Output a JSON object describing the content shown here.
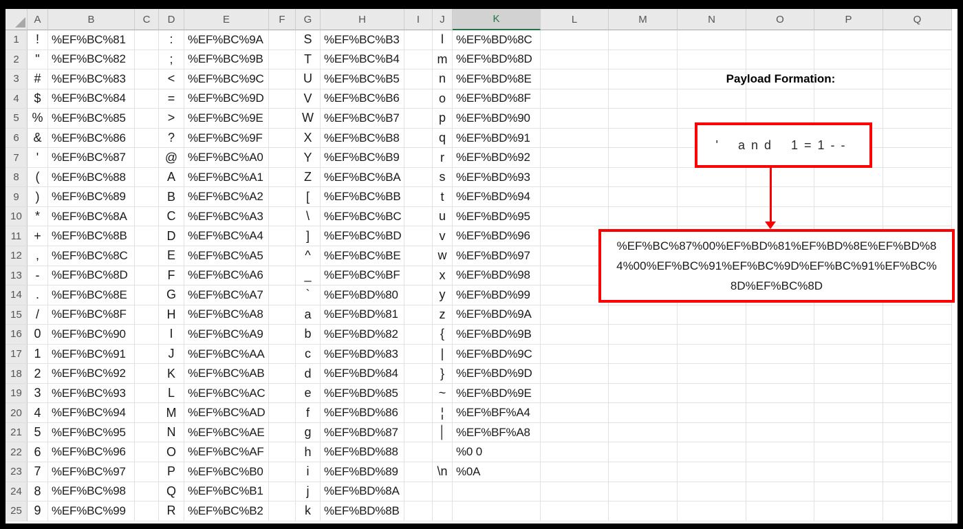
{
  "colors": {
    "annotation_red": "#fb0000",
    "excel_selected_green": "#217346",
    "header_bg": "#e9e9e9",
    "selected_header_bg": "#d2d2d2",
    "gridline": "#e2e2e2",
    "frame": "#000000"
  },
  "sheet": {
    "col_headers": [
      "A",
      "B",
      "C",
      "D",
      "E",
      "F",
      "G",
      "H",
      "I",
      "J",
      "K",
      "L",
      "M",
      "N",
      "O",
      "P",
      "Q"
    ],
    "selected_column": "K",
    "row_numbers": [
      1,
      2,
      3,
      4,
      5,
      6,
      7,
      8,
      9,
      10,
      11,
      12,
      13,
      14,
      15,
      16,
      17,
      18,
      19,
      20,
      21,
      22,
      23,
      24,
      25
    ],
    "rows": [
      [
        "!",
        "%EF%BC%81",
        ":",
        "%EF%BC%9A",
        "S",
        "%EF%BC%B3",
        "l",
        "%EF%BD%8C"
      ],
      [
        "\"",
        "%EF%BC%82",
        ";",
        "%EF%BC%9B",
        "T",
        "%EF%BC%B4",
        "m",
        "%EF%BD%8D"
      ],
      [
        "#",
        "%EF%BC%83",
        "<",
        "%EF%BC%9C",
        "U",
        "%EF%BC%B5",
        "n",
        "%EF%BD%8E"
      ],
      [
        "$",
        "%EF%BC%84",
        "=",
        "%EF%BC%9D",
        "V",
        "%EF%BC%B6",
        "o",
        "%EF%BD%8F"
      ],
      [
        "%",
        "%EF%BC%85",
        ">",
        "%EF%BC%9E",
        "W",
        "%EF%BC%B7",
        "p",
        "%EF%BD%90"
      ],
      [
        "&",
        "%EF%BC%86",
        "?",
        "%EF%BC%9F",
        "X",
        "%EF%BC%B8",
        "q",
        "%EF%BD%91"
      ],
      [
        "'",
        "%EF%BC%87",
        "@",
        "%EF%BC%A0",
        "Y",
        "%EF%BC%B9",
        "r",
        "%EF%BD%92"
      ],
      [
        "(",
        "%EF%BC%88",
        "A",
        "%EF%BC%A1",
        "Z",
        "%EF%BC%BA",
        "s",
        "%EF%BD%93"
      ],
      [
        ")",
        "%EF%BC%89",
        "B",
        "%EF%BC%A2",
        "[",
        "%EF%BC%BB",
        "t",
        "%EF%BD%94"
      ],
      [
        "*",
        "%EF%BC%8A",
        "C",
        "%EF%BC%A3",
        "\\",
        "%EF%BC%BC",
        "u",
        "%EF%BD%95"
      ],
      [
        "+",
        "%EF%BC%8B",
        "D",
        "%EF%BC%A4",
        "]",
        "%EF%BC%BD",
        "v",
        "%EF%BD%96"
      ],
      [
        ",",
        "%EF%BC%8C",
        "E",
        "%EF%BC%A5",
        "^",
        "%EF%BC%BE",
        "w",
        "%EF%BD%97"
      ],
      [
        "-",
        "%EF%BC%8D",
        "F",
        "%EF%BC%A6",
        "_",
        "%EF%BC%BF",
        "x",
        "%EF%BD%98"
      ],
      [
        ".",
        "%EF%BC%8E",
        "G",
        "%EF%BC%A7",
        "`",
        "%EF%BD%80",
        "y",
        "%EF%BD%99"
      ],
      [
        "/",
        "%EF%BC%8F",
        "H",
        "%EF%BC%A8",
        "a",
        "%EF%BD%81",
        "z",
        "%EF%BD%9A"
      ],
      [
        "0",
        "%EF%BC%90",
        "I",
        "%EF%BC%A9",
        "b",
        "%EF%BD%82",
        "{",
        "%EF%BD%9B"
      ],
      [
        "1",
        "%EF%BC%91",
        "J",
        "%EF%BC%AA",
        "c",
        "%EF%BD%83",
        "|",
        "%EF%BD%9C"
      ],
      [
        "2",
        "%EF%BC%92",
        "K",
        "%EF%BC%AB",
        "d",
        "%EF%BD%84",
        "}",
        "%EF%BD%9D"
      ],
      [
        "3",
        "%EF%BC%93",
        "L",
        "%EF%BC%AC",
        "e",
        "%EF%BD%85",
        "~",
        "%EF%BD%9E"
      ],
      [
        "4",
        "%EF%BC%94",
        "M",
        "%EF%BC%AD",
        "f",
        "%EF%BD%86",
        "¦",
        "%EF%BF%A4"
      ],
      [
        "5",
        "%EF%BC%95",
        "N",
        "%EF%BC%AE",
        "g",
        "%EF%BD%87",
        "│",
        "%EF%BF%A8"
      ],
      [
        "6",
        "%EF%BC%96",
        "O",
        "%EF%BC%AF",
        "h",
        "%EF%BD%88",
        "",
        "%0 0"
      ],
      [
        "7",
        "%EF%BC%97",
        "P",
        "%EF%BC%B0",
        "i",
        "%EF%BD%89",
        "\\n",
        "%0A"
      ],
      [
        "8",
        "%EF%BC%98",
        "Q",
        "%EF%BC%B1",
        "j",
        "%EF%BD%8A",
        "",
        ""
      ],
      [
        "9",
        "%EF%BC%99",
        "R",
        "%EF%BC%B2",
        "k",
        "%EF%BD%8B",
        "",
        ""
      ]
    ]
  },
  "annotation": {
    "title": "Payload Formation:",
    "input_text": "' and 1=1--",
    "payload_lines": [
      "%EF%BC%87%00%EF%BD%81%EF%BD%8E%EF%BD%8",
      "4%00%EF%BC%91%EF%BC%9D%EF%BC%91%EF%BC%",
      "8D%EF%BC%8D"
    ],
    "payload_full": "%EF%BC%87%00%EF%BD%81%EF%BD%8E%EF%BD%84%00%EF%BC%91%EF%BC%9D%EF%BC%91%EF%BC%8D%EF%BC%8D"
  }
}
